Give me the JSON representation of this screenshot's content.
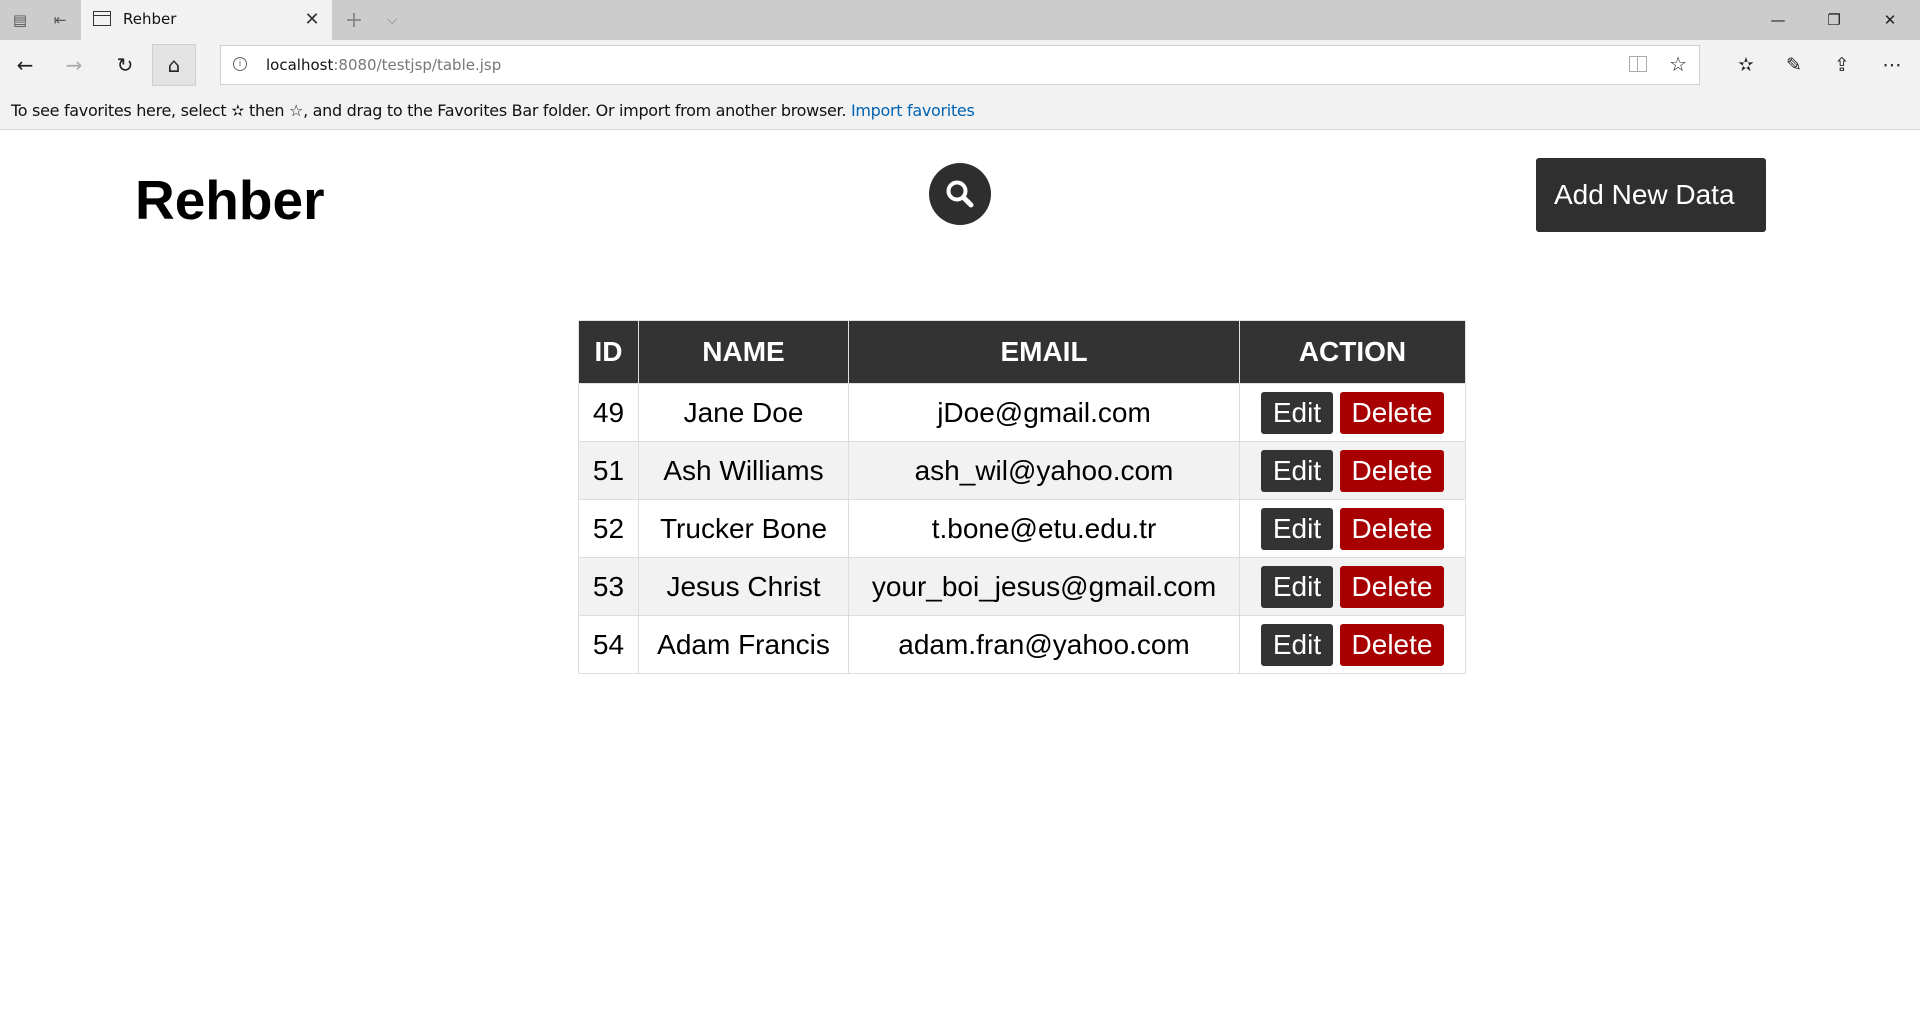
{
  "browser": {
    "tab_title": "Rehber",
    "url_host": "localhost",
    "url_path": ":8080/testjsp/table.jsp",
    "favorites_message": "To see favorites here, select ✫ then ☆, and drag to the Favorites Bar folder. Or import from another browser.",
    "import_favorites_link": "Import favorites"
  },
  "page": {
    "title": "Rehber",
    "add_button_label": "Add New Data"
  },
  "table": {
    "headers": {
      "id": "ID",
      "name": "NAME",
      "email": "EMAIL",
      "action": "ACTION"
    },
    "rows": [
      {
        "id": "49",
        "name": "Jane Doe",
        "email": "jDoe@gmail.com",
        "edit": "Edit",
        "delete": "Delete"
      },
      {
        "id": "51",
        "name": "Ash Williams",
        "email": "ash_wil@yahoo.com",
        "edit": "Edit",
        "delete": "Delete"
      },
      {
        "id": "52",
        "name": "Trucker Bone",
        "email": "t.bone@etu.edu.tr",
        "edit": "Edit",
        "delete": "Delete"
      },
      {
        "id": "53",
        "name": "Jesus Christ",
        "email": "your_boi_jesus@gmail.com",
        "edit": "Edit",
        "delete": "Delete"
      },
      {
        "id": "54",
        "name": "Adam Francis",
        "email": "adam.fran@yahoo.com",
        "edit": "Edit",
        "delete": "Delete"
      }
    ]
  },
  "colors": {
    "dark": "#333333",
    "delete_red": "#a80000",
    "link_blue": "#0063b1"
  }
}
